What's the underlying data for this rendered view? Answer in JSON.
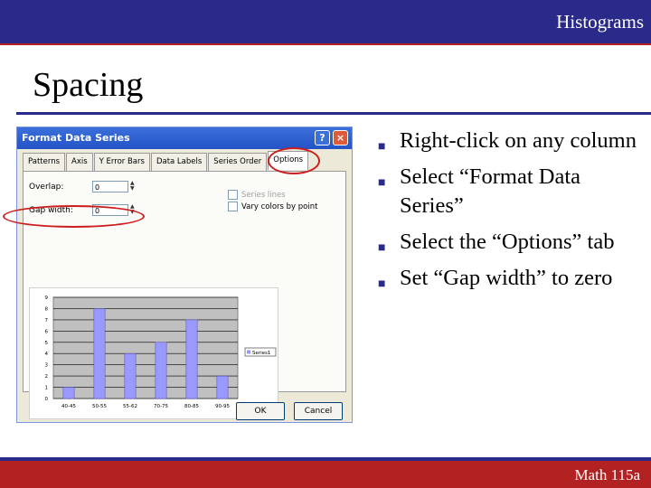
{
  "header": {
    "title": "Histograms"
  },
  "slide": {
    "title": "Spacing",
    "bullets": [
      "Right-click on any column",
      "Select “Format Data Series”",
      "Select the “Options” tab",
      "Set “Gap width” to zero"
    ]
  },
  "footer": {
    "text": "Math 115a"
  },
  "dialog": {
    "title": "Format Data Series",
    "help_label": "?",
    "close_label": "×",
    "tabs": [
      "Patterns",
      "Axis",
      "Y Error Bars",
      "Data Labels",
      "Series Order",
      "Options"
    ],
    "active_tab": "Options",
    "overlap": {
      "label": "Overlap:",
      "value": "0"
    },
    "gap_width": {
      "label": "Gap width:",
      "value": "0"
    },
    "series_lines_label": "Series lines",
    "vary_colors_label": "Vary colors by point",
    "ok_label": "OK",
    "cancel_label": "Cancel"
  },
  "colors": {
    "header_blue": "#2a2a8a",
    "footer_red": "#b22222",
    "bar_fill": "#9999ff",
    "highlight": "#cc1e1e"
  },
  "chart_data": {
    "type": "bar",
    "categories": [
      "40-45",
      "50-55",
      "55-62",
      "70-75",
      "80-85",
      "90-95"
    ],
    "values": [
      1,
      8,
      4,
      5,
      7,
      2
    ],
    "ylim": [
      0,
      9
    ],
    "yticks": [
      "0",
      "1",
      "2",
      "3",
      "4",
      "5",
      "6",
      "7",
      "8",
      "9"
    ],
    "legend": "Series1",
    "legend_position": "right",
    "grid": true
  }
}
